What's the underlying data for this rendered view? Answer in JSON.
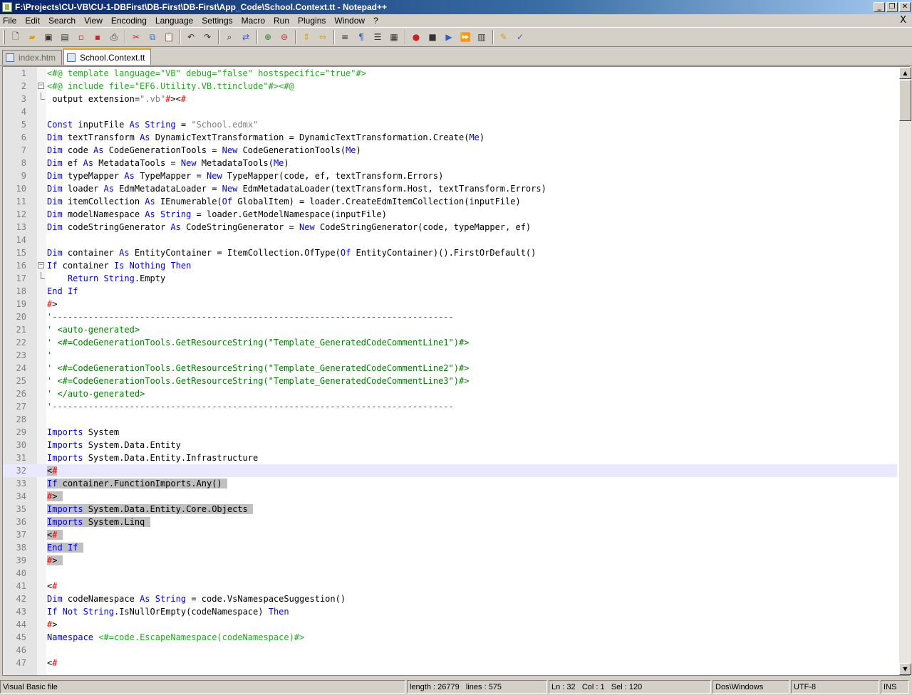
{
  "window": {
    "title": "F:\\Projects\\CU-VB\\CU-1-DBFirst\\DB-First\\DB-First\\App_Code\\School.Context.tt - Notepad++",
    "minimize_label": "_",
    "restore_label": "❐",
    "close_label": "✕"
  },
  "menu": {
    "items": [
      "File",
      "Edit",
      "Search",
      "View",
      "Encoding",
      "Language",
      "Settings",
      "Macro",
      "Run",
      "Plugins",
      "Window",
      "?"
    ],
    "close_label": "X"
  },
  "toolbar": {
    "icons": [
      "new-file-icon",
      "open-file-icon",
      "save-icon",
      "save-all-icon",
      "close-icon",
      "close-all-icon",
      "print-icon",
      "cut-icon",
      "copy-icon",
      "paste-icon",
      "undo-icon",
      "redo-icon",
      "find-icon",
      "replace-icon",
      "zoom-in-icon",
      "zoom-out-icon",
      "sync-vertical-icon",
      "sync-horizontal-icon",
      "word-wrap-icon",
      "show-all-chars-icon",
      "indent-guide-icon",
      "document-map-icon",
      "record-macro-icon",
      "stop-record-icon",
      "play-macro-icon",
      "run-macro-multiple-icon",
      "save-macro-icon",
      "spell-check-icon",
      "abc-spell-icon"
    ]
  },
  "tabs": [
    {
      "label": "index.htm",
      "active": false
    },
    {
      "label": "School.Context.tt",
      "active": true
    }
  ],
  "editor": {
    "current_line": 32,
    "lines": [
      {
        "n": "1",
        "t": "<#@ template language=\"VB\" debug=\"false\" hostspecific=\"true\"#>"
      },
      {
        "n": "2",
        "t": "<#@ include file=\"EF6.Utility.VB.ttinclude\"#><#@"
      },
      {
        "n": "3",
        "t": " output extension=\".vb\"#><#"
      },
      {
        "n": "4",
        "t": ""
      },
      {
        "n": "5",
        "t": "Const inputFile As String = \"School.edmx\""
      },
      {
        "n": "6",
        "t": "Dim textTransform As DynamicTextTransformation = DynamicTextTransformation.Create(Me)"
      },
      {
        "n": "7",
        "t": "Dim code As CodeGenerationTools = New CodeGenerationTools(Me)"
      },
      {
        "n": "8",
        "t": "Dim ef As MetadataTools = New MetadataTools(Me)"
      },
      {
        "n": "9",
        "t": "Dim typeMapper As TypeMapper = New TypeMapper(code, ef, textTransform.Errors)"
      },
      {
        "n": "10",
        "t": "Dim loader As EdmMetadataLoader = New EdmMetadataLoader(textTransform.Host, textTransform.Errors)"
      },
      {
        "n": "11",
        "t": "Dim itemCollection As IEnumerable(Of GlobalItem) = loader.CreateEdmItemCollection(inputFile)"
      },
      {
        "n": "12",
        "t": "Dim modelNamespace As String = loader.GetModelNamespace(inputFile)"
      },
      {
        "n": "13",
        "t": "Dim codeStringGenerator As CodeStringGenerator = New CodeStringGenerator(code, typeMapper, ef)"
      },
      {
        "n": "14",
        "t": ""
      },
      {
        "n": "15",
        "t": "Dim container As EntityContainer = ItemCollection.OfType(Of EntityContainer)().FirstOrDefault()"
      },
      {
        "n": "16",
        "t": "If container Is Nothing Then"
      },
      {
        "n": "17",
        "t": "    Return String.Empty"
      },
      {
        "n": "18",
        "t": "End If"
      },
      {
        "n": "19",
        "t": "#>"
      },
      {
        "n": "20",
        "t": "'------------------------------------------------------------------------------"
      },
      {
        "n": "21",
        "t": "' <auto-generated>"
      },
      {
        "n": "22",
        "t": "' <#=CodeGenerationTools.GetResourceString(\"Template_GeneratedCodeCommentLine1\")#>"
      },
      {
        "n": "23",
        "t": "'"
      },
      {
        "n": "24",
        "t": "' <#=CodeGenerationTools.GetResourceString(\"Template_GeneratedCodeCommentLine2\")#>"
      },
      {
        "n": "25",
        "t": "' <#=CodeGenerationTools.GetResourceString(\"Template_GeneratedCodeCommentLine3\")#>"
      },
      {
        "n": "26",
        "t": "' </auto-generated>"
      },
      {
        "n": "27",
        "t": "'------------------------------------------------------------------------------"
      },
      {
        "n": "28",
        "t": ""
      },
      {
        "n": "29",
        "t": "Imports System"
      },
      {
        "n": "30",
        "t": "Imports System.Data.Entity"
      },
      {
        "n": "31",
        "t": "Imports System.Data.Entity.Infrastructure"
      },
      {
        "n": "32",
        "t": "<#"
      },
      {
        "n": "33",
        "t": "If container.FunctionImports.Any()"
      },
      {
        "n": "34",
        "t": "#>"
      },
      {
        "n": "35",
        "t": "Imports System.Data.Entity.Core.Objects"
      },
      {
        "n": "36",
        "t": "Imports System.Linq"
      },
      {
        "n": "37",
        "t": "<#"
      },
      {
        "n": "38",
        "t": "End If"
      },
      {
        "n": "39",
        "t": "#>"
      },
      {
        "n": "40",
        "t": ""
      },
      {
        "n": "41",
        "t": "<#"
      },
      {
        "n": "42",
        "t": "Dim codeNamespace As String = code.VsNamespaceSuggestion()"
      },
      {
        "n": "43",
        "t": "If Not String.IsNullOrEmpty(codeNamespace) Then"
      },
      {
        "n": "44",
        "t": "#>"
      },
      {
        "n": "45",
        "t": "Namespace <#=code.EscapeNamespace(codeNamespace)#>"
      },
      {
        "n": "46",
        "t": ""
      },
      {
        "n": "47",
        "t": "<#"
      }
    ]
  },
  "status": {
    "file_type": "Visual Basic file",
    "length": "length : 26779",
    "lines": "lines : 575",
    "ln": "Ln : 32",
    "col": "Col : 1",
    "sel": "Sel : 120",
    "eol": "Dos\\Windows",
    "encoding": "UTF-8",
    "mode": "INS"
  }
}
